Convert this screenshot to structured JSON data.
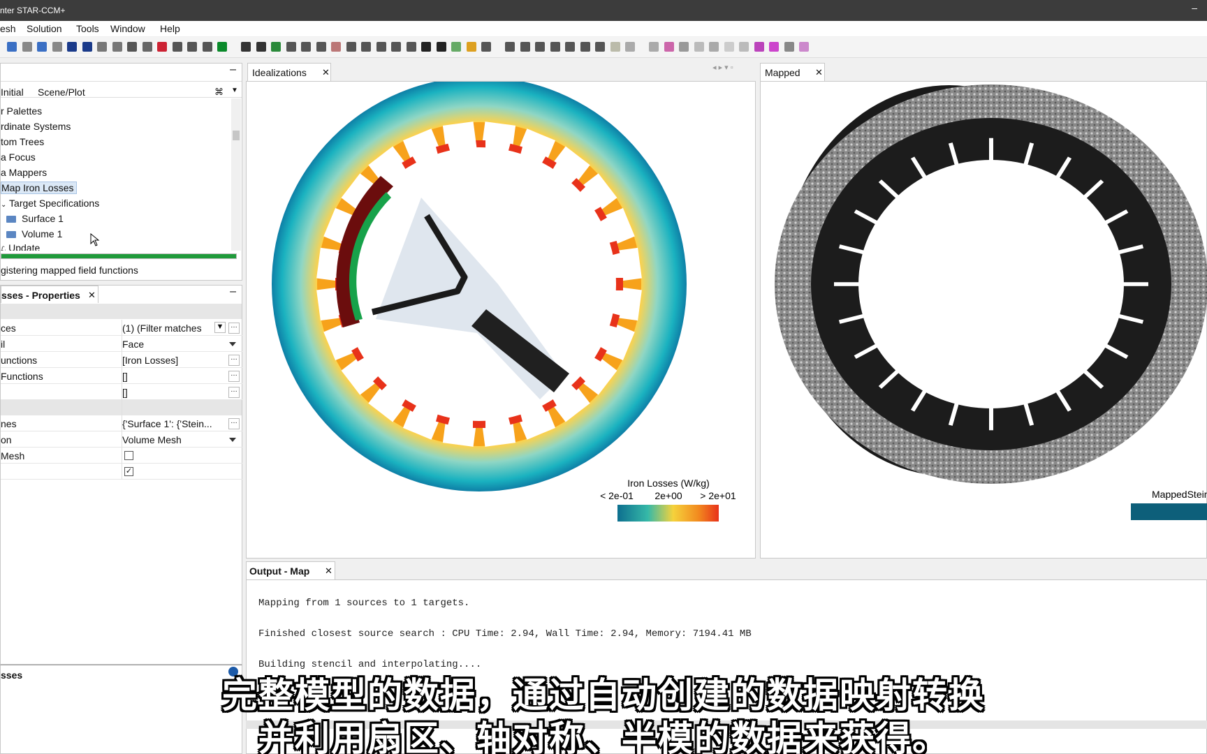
{
  "window": {
    "title": "nter STAR-CCM+"
  },
  "menu": {
    "items": [
      "esh",
      "Solution",
      "Tools",
      "Window",
      "Help"
    ]
  },
  "tree": {
    "tabs": [
      "Initial",
      "Scene/Plot"
    ],
    "items": [
      "r Palettes",
      "rdinate Systems",
      "tom Trees",
      "a Focus",
      "a Mappers",
      "Map Iron Losses",
      "Target Specifications",
      "Surface 1",
      "Volume 1",
      "Update"
    ],
    "status": "gistering mapped field functions",
    "progress": 1.0
  },
  "props": {
    "title": "sses - Properties",
    "rows": [
      {
        "k": "ces",
        "v": "(1) (Filter matches"
      },
      {
        "k": "il",
        "v": "Face"
      },
      {
        "k": "unctions",
        "v": "[Iron Losses]"
      },
      {
        "k": "Functions",
        "v": "[]"
      },
      {
        "k": "",
        "v": "[]"
      },
      {
        "k": "nes",
        "v": "{'Surface 1': {'Stein..."
      },
      {
        "k": "on",
        "v": "Volume Mesh"
      },
      {
        "k": "Mesh",
        "v": ""
      },
      {
        "k": "",
        "v": ""
      }
    ],
    "bottom": "sses"
  },
  "views": {
    "left_tab": "Idealizations",
    "right_tab": "Mapped",
    "legend_title": "Iron Losses (W/kg)",
    "legend_ticks": [
      "< 2e-01",
      "2e+00",
      "> 2e+01"
    ],
    "right_legend": "MappedSteinmetz Los"
  },
  "output": {
    "tab": "Output - Map",
    "lines": [
      "Mapping from 1 sources to 1 targets.",
      "Finished closest source search : CPU Time: 2.94, Wall Time: 2.94, Memory: 7194.41 MB",
      "Building stencil and interpolating....",
      "e Lami                                   .         cal      ."
    ]
  },
  "subtitles": [
    "完整模型的数据，通过自动创建的数据映射转换",
    "并利用扇区、轴对称、半模的数据来获得。"
  ],
  "colors": {
    "accent": "#1f9a3a",
    "legend_low": "#0d6f8f",
    "legend_high": "#e8321a"
  }
}
